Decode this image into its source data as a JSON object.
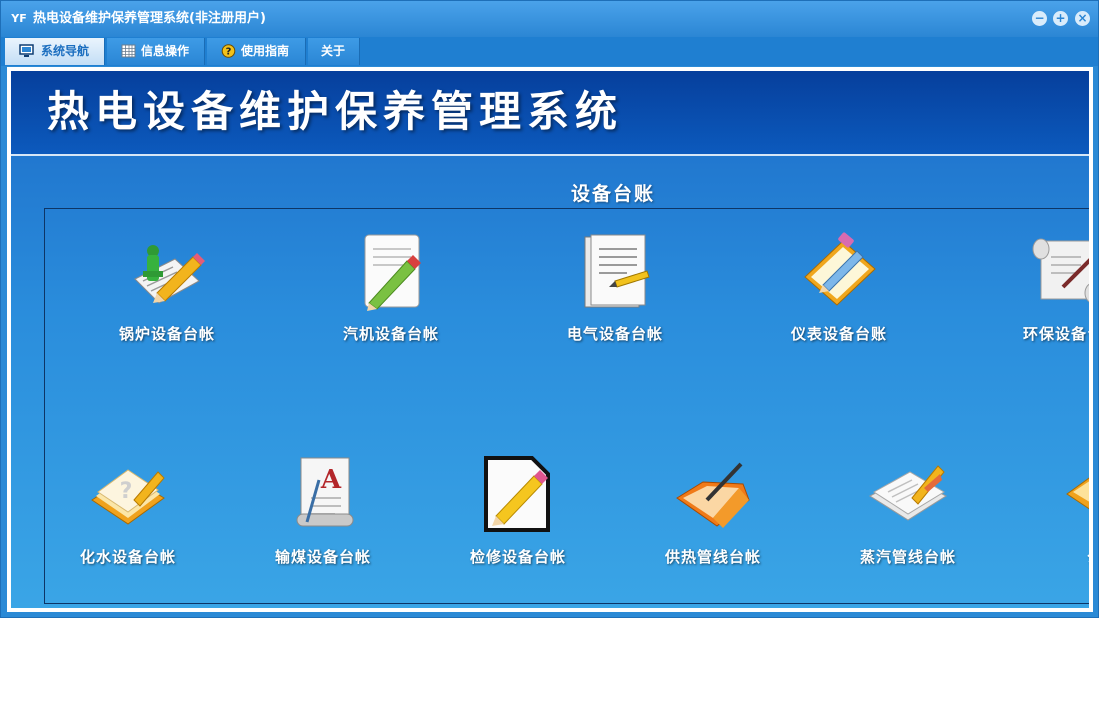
{
  "window": {
    "title": "热电设备维护保养管理系统(非注册用户)",
    "icon": "app-logo-icon",
    "app_logo_text": "YF",
    "controls": {
      "minimize": "−",
      "maximize": "+",
      "close": "×"
    }
  },
  "menu": {
    "tabs": [
      {
        "label": "系统导航",
        "icon": "monitor-icon",
        "active": true
      },
      {
        "label": "信息操作",
        "icon": "grid-icon",
        "active": false
      },
      {
        "label": "使用指南",
        "icon": "help-icon",
        "active": false
      },
      {
        "label": "关于",
        "icon": "",
        "active": false
      }
    ]
  },
  "banner": {
    "title": "热电设备维护保养管理系统"
  },
  "section": {
    "title": "设备台账",
    "items": [
      {
        "label": "锅炉设备台帐",
        "icon": "boiler-document-icon"
      },
      {
        "label": "汽机设备台帐",
        "icon": "notepad-pencil-icon"
      },
      {
        "label": "电气设备台帐",
        "icon": "notebook-pen-icon"
      },
      {
        "label": "仪表设备台账",
        "icon": "clipboard-pen-icon"
      },
      {
        "label": "环保设备台",
        "icon": "scroll-quill-icon"
      },
      {
        "label": "化水设备台帐",
        "icon": "notebook-question-icon"
      },
      {
        "label": "输煤设备台帐",
        "icon": "document-a-icon"
      },
      {
        "label": "检修设备台帐",
        "icon": "edit-pencil-icon"
      },
      {
        "label": "供热管线台帐",
        "icon": "folder-pen-icon"
      },
      {
        "label": "蒸汽管线台帐",
        "icon": "papers-pencil-icon"
      },
      {
        "label": "公共",
        "icon": "notes-icon"
      }
    ]
  },
  "colors": {
    "titlebar": "#2b86d4",
    "banner": "#063f9c",
    "background_top": "#1c6cc8",
    "background_bottom": "#3aa5e6",
    "text": "#ffffff"
  }
}
